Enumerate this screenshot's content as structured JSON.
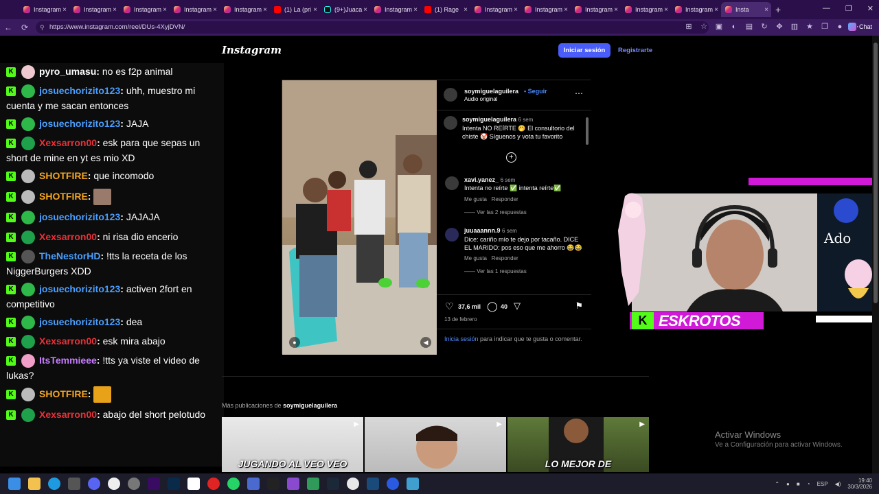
{
  "browser": {
    "tabs": [
      {
        "label": "Instagram",
        "favicon": "instagram-icon"
      },
      {
        "label": "Instagram",
        "favicon": "instagram-icon"
      },
      {
        "label": "Instagram",
        "favicon": "instagram-icon"
      },
      {
        "label": "Instagram",
        "favicon": "instagram-icon"
      },
      {
        "label": "Instagram",
        "favicon": "instagram-icon"
      },
      {
        "label": "(1) La (pri",
        "favicon": "youtube-icon"
      },
      {
        "label": "(9+)Juaca",
        "favicon": "tiktok-icon"
      },
      {
        "label": "Instagram",
        "favicon": "instagram-icon"
      },
      {
        "label": "(1) Rage",
        "favicon": "youtube-icon"
      },
      {
        "label": "Instagram",
        "favicon": "instagram-icon"
      },
      {
        "label": "Instagram",
        "favicon": "instagram-icon"
      },
      {
        "label": "Instagram",
        "favicon": "instagram-icon"
      },
      {
        "label": "Instagram",
        "favicon": "instagram-icon"
      },
      {
        "label": "Instagram",
        "favicon": "instagram-icon"
      },
      {
        "label": "Insta",
        "favicon": "instagram-icon",
        "active": true
      }
    ],
    "url": "https://www.instagram.com/reel/DUs-4XyjDVN/",
    "chat_label": "Chat"
  },
  "chat": {
    "messages": [
      {
        "user": "pyro_umasu",
        "color": "#ffffff",
        "text": "no es f2p animal"
      },
      {
        "user": "josuechorizito123",
        "color": "#4a9fff",
        "text": "uhh, muestro mi cuenta y me sacan entonces"
      },
      {
        "user": "josuechorizito123",
        "color": "#4a9fff",
        "text": "JAJA"
      },
      {
        "user": "Xexsarron00",
        "color": "#e8323a",
        "text": "esk para que sepas un short de mine en yt es mio XD"
      },
      {
        "user": "SHOTFIRE",
        "color": "#f5a623",
        "text": "que incomodo"
      },
      {
        "user": "SHOTFIRE",
        "color": "#f5a623",
        "text": ""
      },
      {
        "user": "josuechorizito123",
        "color": "#4a9fff",
        "text": "JAJAJA"
      },
      {
        "user": "Xexsarron00",
        "color": "#e8323a",
        "text": "ni risa dio encerio"
      },
      {
        "user": "TheNestorHD",
        "color": "#4a9fff",
        "text": "!tts la receta de los NiggerBurgers XDD"
      },
      {
        "user": "josuechorizito123",
        "color": "#4a9fff",
        "text": "activen 2fort en competitivo"
      },
      {
        "user": "josuechorizito123",
        "color": "#4a9fff",
        "text": "dea"
      },
      {
        "user": "Xexsarron00",
        "color": "#e8323a",
        "text": "esk mira abajo"
      },
      {
        "user": "ItsTemmieee",
        "color": "#c77dff",
        "text": "!tts ya viste el video de lukas?"
      },
      {
        "user": "SHOTFIRE",
        "color": "#f5a623",
        "text": ""
      },
      {
        "user": "Xexsarron00",
        "color": "#e8323a",
        "text": "abajo del short pelotudo"
      }
    ]
  },
  "instagram": {
    "logo": "Instagram",
    "login_label": "Iniciar sesión",
    "register_label": "Registrarte",
    "post": {
      "author": "soymiguelaguilera",
      "follow_label": "Seguir",
      "audio": "Audio original",
      "caption_author": "soymiguelaguilera",
      "caption_time": "6 sem",
      "caption_text": "Intenta NO REÍRTE 🤭 El consultorio del chiste 🤡 Síguenos y vota tu favorito",
      "comments": [
        {
          "user": "xavi.yanez_",
          "time": "6 sem",
          "text": "Intenta no reírte ✅ intenta reírte✅",
          "like": "Me gusta",
          "reply": "Responder",
          "replies": "Ver las 2 respuestas"
        },
        {
          "user": "juuaaannn.9",
          "time": "6 sem",
          "text": "Dice: cariño mío te dejo por tacaño. DICE EL MARIDO: pos eso que me ahorro 😂😂",
          "like": "Me gusta",
          "reply": "Responder",
          "replies": "Ver las 1 respuestas"
        }
      ],
      "likes": "37,6 mil",
      "comments_count": "40",
      "date": "13 de febrero",
      "login_prompt_link": "Inicia sesión",
      "login_prompt_text": "para indicar que te gusta o comentar."
    },
    "more_prefix": "Más publicaciones de",
    "more_author": "soymiguelaguilera",
    "thumbs": [
      {
        "caption": "JUGANDO AL VEO VEO"
      },
      {
        "caption": ""
      },
      {
        "caption": "LO MEJOR DE"
      }
    ]
  },
  "stream": {
    "name": "ESKROTOS",
    "k": "K"
  },
  "windows": {
    "activate_title": "Activar Windows",
    "activate_sub": "Ve a Configuración para activar Windows."
  },
  "tray": {
    "lang": "ESP",
    "time": "19:40",
    "date": "30/3/2026"
  }
}
